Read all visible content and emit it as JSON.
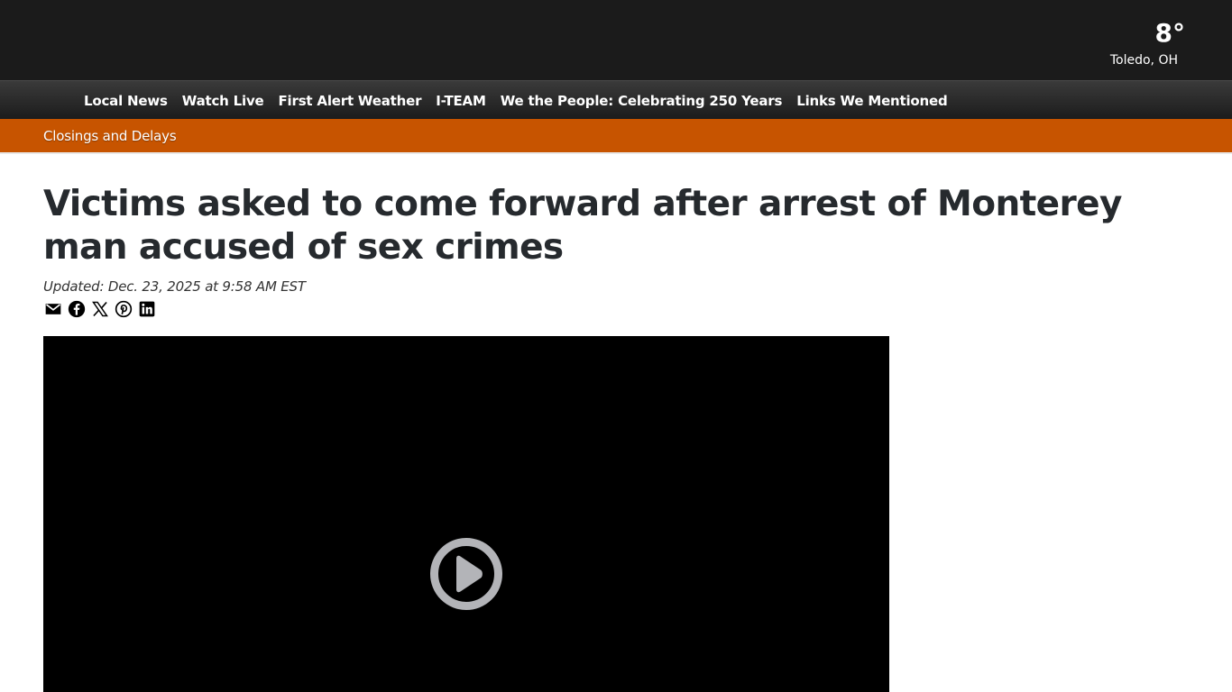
{
  "weather": {
    "temperature": "8°",
    "location": "Toledo, OH"
  },
  "nav": {
    "menu_icon": "",
    "links": [
      {
        "label": "Local News"
      },
      {
        "label": "Watch Live"
      },
      {
        "label": "First Alert Weather"
      },
      {
        "label": "I-TEAM"
      },
      {
        "label": "We the People: Celebrating 250 Years"
      },
      {
        "label": "Links We Mentioned"
      }
    ],
    "search_icon": ""
  },
  "alert_bar": {
    "label": "Closings and Delays",
    "icon": "",
    "color": "#c75400"
  },
  "article": {
    "headline": "Victims asked to come forward after arrest of Monterey man accused of sex crimes",
    "updated": "Updated: Dec. 23, 2025 at 9:58 AM EST"
  },
  "share_icons": [
    "email-icon",
    "facebook-icon",
    "x-icon",
    "pinterest-icon",
    "linkedin-icon"
  ],
  "video": {
    "play_icon": "play-circle-icon"
  },
  "colors": {
    "topbar": "#1b1b1b",
    "navbar": "#2a2a2a",
    "accent": "#c75400",
    "headline": "#262a2e"
  }
}
